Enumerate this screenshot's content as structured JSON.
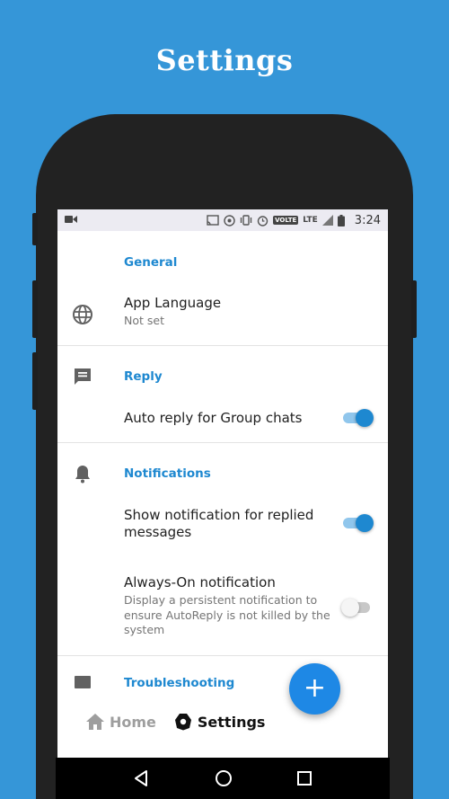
{
  "page_title": "Settings",
  "status_bar": {
    "time": "3:24",
    "volte": "VOLTE",
    "lte": "LTE"
  },
  "sections": {
    "general": {
      "header": "General",
      "app_language": {
        "title": "App Language",
        "subtitle": "Not set"
      }
    },
    "reply": {
      "header": "Reply",
      "group_chats": {
        "title": "Auto reply for Group chats",
        "enabled": true
      }
    },
    "notifications": {
      "header": "Notifications",
      "replied": {
        "title": "Show notification for replied messages",
        "enabled": true
      },
      "always_on": {
        "title": "Always-On notification",
        "subtitle": "Display a persistent notification to ensure AutoReply is not killed by the system",
        "enabled": false
      }
    },
    "troubleshooting": {
      "header": "Troubleshooting"
    }
  },
  "bottom_nav": {
    "home": "Home",
    "settings": "Settings"
  },
  "fab": {
    "label": "+"
  },
  "colors": {
    "background": "#3596d8",
    "accent": "#1e88d0",
    "fab": "#1e88e5"
  }
}
